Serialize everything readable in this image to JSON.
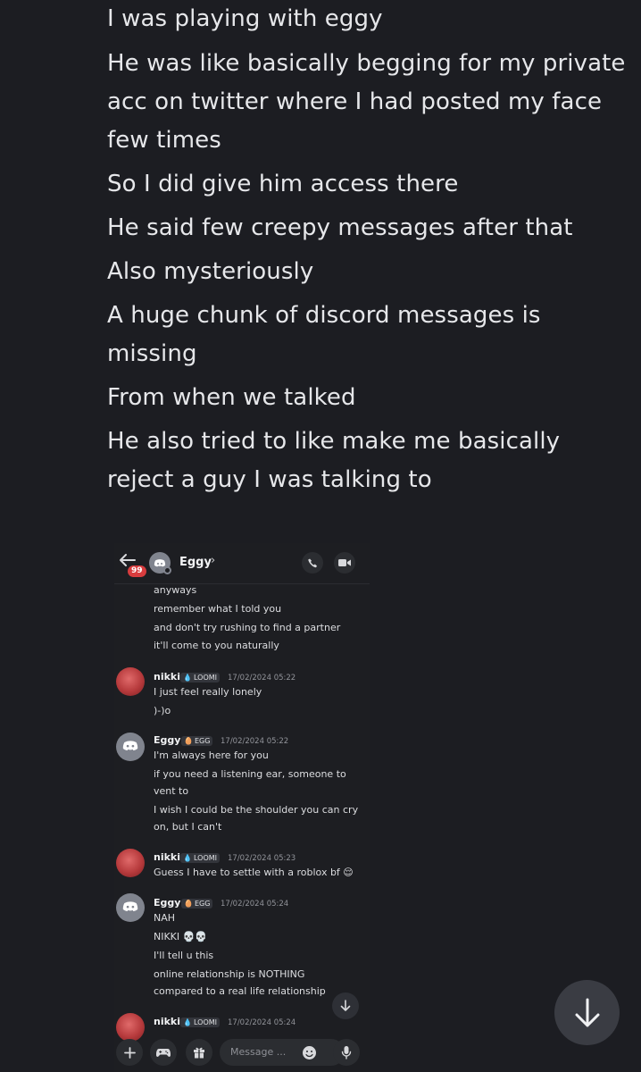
{
  "outer_messages": [
    "I was playing with eggy",
    "He was like basically begging for my private",
    "acc on twitter where I had posted my face",
    "few times",
    "So I did give him access there",
    "He said few creepy messages after that",
    "Also mysteriously",
    "A huge chunk of discord messages is",
    "missing",
    "From when we talked",
    "He also tried to like make me basically",
    "reject a guy I was talking to"
  ],
  "screenshot": {
    "header": {
      "unread_badge": "99",
      "name": "Eggy",
      "chevron": "›",
      "icons": [
        "back-arrow-icon",
        "discord-avatar-icon",
        "call-icon",
        "video-icon"
      ]
    },
    "continued_lines": [
      "anyways",
      "remember what I told you",
      "and don't try rushing to find a partner",
      "it'll come to you naturally"
    ],
    "messages": [
      {
        "author": "nikki",
        "tag": "LOOMI",
        "timestamp": "17/02/2024 05:22",
        "lines": [
          "I just feel really lonely",
          ")-)o"
        ]
      },
      {
        "author": "Eggy",
        "tag": "EGG",
        "timestamp": "17/02/2024 05:22",
        "lines": [
          "I'm always here for you",
          "if you need a listening ear, someone to",
          "vent to",
          "I wish I could be the shoulder you can cry",
          "on, but I can't"
        ]
      },
      {
        "author": "nikki",
        "tag": "LOOMI",
        "timestamp": "17/02/2024 05:23",
        "lines": [
          "Guess I have to settle with a roblox bf 😌"
        ]
      },
      {
        "author": "Eggy",
        "tag": "EGG",
        "timestamp": "17/02/2024 05:24",
        "lines": [
          "NAH",
          "NIKKI 💀💀",
          "I'll tell u this",
          "online relationship is NOTHING",
          "compared to a real life relationship"
        ]
      },
      {
        "author": "nikki",
        "tag": "LOOMI",
        "timestamp": "17/02/2024 05:24",
        "lines": []
      }
    ],
    "composer": {
      "placeholder": "Message ...",
      "icons": [
        "plus-icon",
        "gamepad-icon",
        "gift-icon",
        "emoji-icon",
        "microphone-icon"
      ]
    }
  },
  "colors": {
    "background": "#1c1d22",
    "text": "#e6e7ea",
    "badge": "#d83c3e",
    "bubble": "#2b2d31"
  }
}
